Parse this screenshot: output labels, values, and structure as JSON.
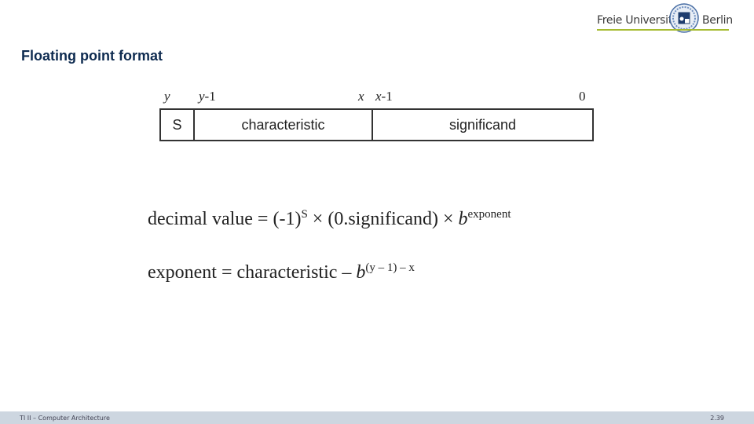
{
  "header": {
    "logo_left": "Freie Universität",
    "logo_right": "Berlin",
    "accent_color": "#a5bb2f"
  },
  "slide": {
    "title": "Floating point format",
    "bit_labels": {
      "y": "y",
      "y_minus_1_var": "y",
      "y_minus_1_suffix": "-1",
      "x": "x",
      "x_minus_1_var": "x",
      "x_minus_1_suffix": "-1",
      "zero": "0"
    },
    "fields": {
      "sign": "S",
      "characteristic": "characteristic",
      "significand": "significand"
    },
    "formula1": {
      "lhs": "decimal value = (-1)",
      "sup_s": "S",
      "mid": " × (0.significand) × ",
      "base": "b",
      "sup_exp": "exponent"
    },
    "formula2": {
      "lhs": "exponent = characteristic – ",
      "base": "b",
      "sup": "(y – 1) – x"
    }
  },
  "footer": {
    "course": "TI II – Computer Architecture",
    "page": "2.39"
  }
}
